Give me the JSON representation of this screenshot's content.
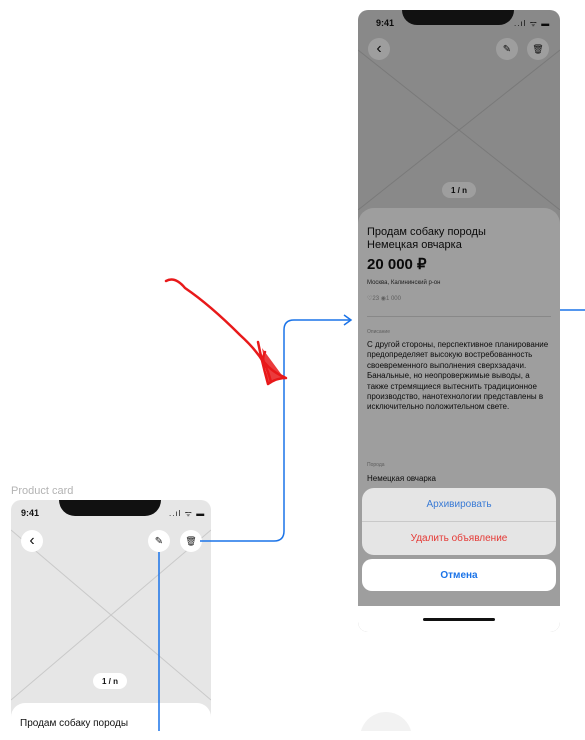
{
  "frame_label": "Product card",
  "left_phone": {
    "time": "9:41",
    "status_icons": "..ıl ᯤ ▬",
    "back_icon": "‹",
    "edit_icon": "✎",
    "delete_icon": "🗑",
    "pager": "1 / n",
    "title": "Продам собаку породы"
  },
  "right_phone": {
    "time": "9:41",
    "status_icons": "..ıl ᯤ ▬",
    "back_icon": "‹",
    "edit_icon": "✎",
    "delete_icon": "🗑",
    "pager": "1 / n",
    "title_line1": "Продам собаку породы",
    "title_line2": "Немецкая овчарка",
    "price": "20 000 ₽",
    "location": "Москва, Калининский р-он",
    "stats": "♡23 ◉1 000",
    "description_label": "Описание",
    "description": "С другой стороны, перспективное планирование предопределяет высокую востребованность своевременного выполнения сверхзадачи. Банальные, но неопровержимые выводы, а также стремящиеся вытеснить традиционное производство, нанотехнологии представлены в исключительно положительном свете.",
    "breed_label": "Порода",
    "breed": "Немецкая овчарка"
  },
  "action_sheet": {
    "archive": "Архивировать",
    "delete": "Удалить объявление",
    "cancel": "Отмена"
  },
  "colors": {
    "link_blue": "#1a73e8",
    "destructive_red": "#e53935",
    "annotation_red": "#e8191a"
  }
}
